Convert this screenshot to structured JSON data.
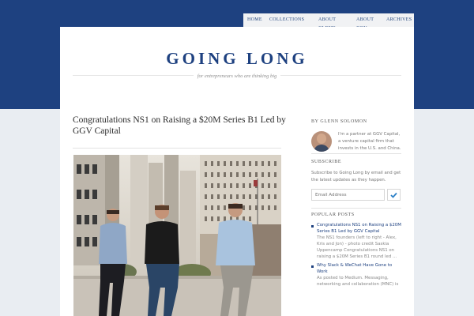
{
  "nav": {
    "items": [
      {
        "label": "HOME"
      },
      {
        "label": "COLLECTIONS"
      },
      {
        "label": "ABOUT GLENN"
      },
      {
        "label": "ABOUT GGV"
      },
      {
        "label": "ARCHIVES"
      }
    ]
  },
  "header": {
    "site_title": "GOING LONG",
    "tagline": "for entrepreneurs who are thinking big"
  },
  "post": {
    "title": "Congratulations NS1 on Raising a $20M Series B1 Led by GGV Capital"
  },
  "sidebar": {
    "author_heading": "BY GLENN SOLOMON",
    "bio": "I'm a partner at GGV Capital, a venture capital firm that invests in the U.S. and China.",
    "social_icons": [
      "twitter-icon",
      "linkedin-icon"
    ],
    "subscribe_heading": "SUBSCRIBE",
    "subscribe_text": "Subscribe to Going Long by email and get the latest updates as they happen.",
    "email_placeholder": "Email Address",
    "popular_heading": "POPULAR POSTS",
    "popular": [
      {
        "title": "Congratulations NS1 on Raising a $20M Series B1 Led by GGV Capital",
        "excerpt": "The NS1 founders (left to right - Alex, Kris and Jon) - photo credit Saskia Uppencamp Congratulations NS1 on raising a $20M Series B1 round led ..."
      },
      {
        "title": "Why Slack & WeChat Have Gone to Work",
        "excerpt": "As posted to Medium. Messaging, networking and collaboration (MNC) is"
      }
    ]
  },
  "colors": {
    "brand_blue": "#1e4180",
    "band": "#1e4180",
    "nav_bg": "#f1f2f4",
    "check_button": "#2a7fc6"
  }
}
